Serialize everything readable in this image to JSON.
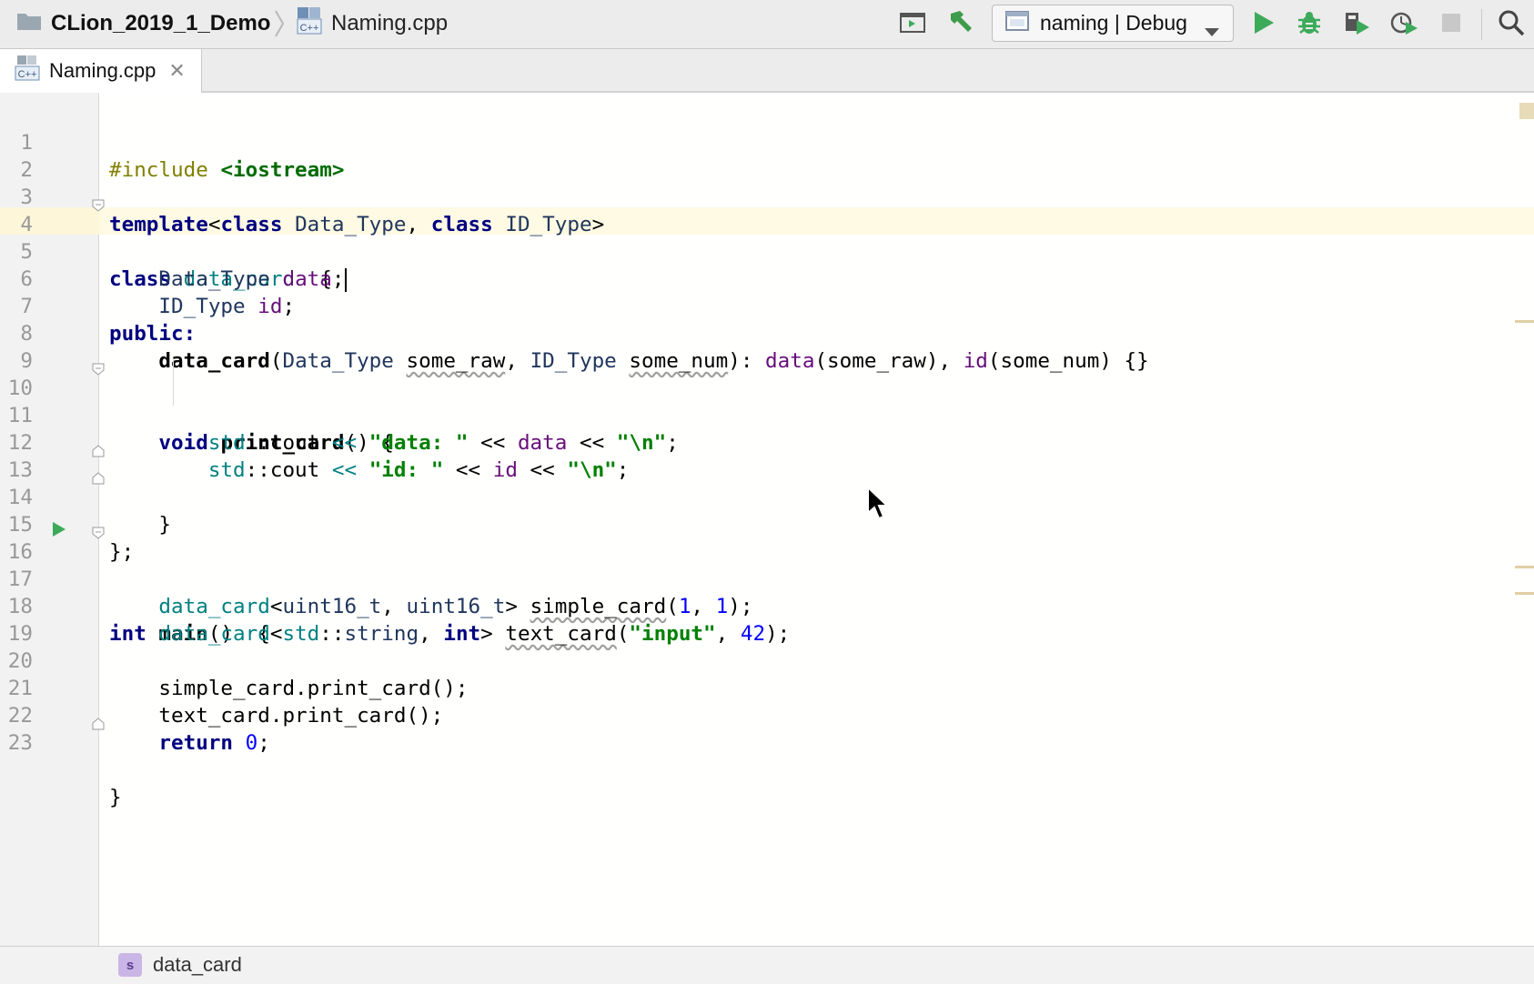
{
  "navbar": {
    "project_name": "CLion_2019_1_Demo",
    "file_name": "Naming.cpp",
    "run_config": "naming | Debug",
    "icons": [
      "terminal-run-icon",
      "build-hammer-icon",
      "run-icon",
      "debug-icon",
      "run-with-coverage-icon",
      "profile-icon",
      "stop-icon",
      "search-icon"
    ]
  },
  "tabs": [
    {
      "label": "Naming.cpp",
      "close": "✕"
    }
  ],
  "editor": {
    "line_numbers": [
      "1",
      "2",
      "3",
      "4",
      "5",
      "6",
      "7",
      "8",
      "9",
      "10",
      "11",
      "12",
      "13",
      "14",
      "15",
      "16",
      "17",
      "18",
      "19",
      "20",
      "21",
      "22",
      "23"
    ],
    "current_line": "5",
    "code": {
      "l1": [
        "#include",
        "<iostream>"
      ],
      "l3": [
        "template",
        "<",
        "class",
        "Data_Type",
        ", ",
        "class",
        "ID_Type",
        ">"
      ],
      "l4": [
        "class",
        "data_card",
        "  {"
      ],
      "l5": [
        "Data_Type",
        "data",
        ";"
      ],
      "l6": [
        "ID_Type",
        "id",
        ";"
      ],
      "l7": [
        "public",
        ":"
      ],
      "l8": [
        "data_card",
        "(",
        "Data_Type",
        "some_raw",
        ", ",
        "ID_Type",
        "some_num",
        "): ",
        "data",
        "(some_raw), ",
        "id",
        "(some_num) {}"
      ],
      "l10": [
        "void",
        "print_card",
        "() {"
      ],
      "l11": [
        "std",
        "::cout ",
        "<<",
        "\"data: \"",
        " << ",
        "data",
        " << ",
        "\"\\n\"",
        ";"
      ],
      "l12": [
        "std",
        "::cout ",
        "<<",
        "\"id: \"",
        " << ",
        "id",
        " << ",
        "\"\\n\"",
        ";"
      ],
      "l13": [
        "}"
      ],
      "l14": [
        "};"
      ],
      "l16": [
        "int",
        "main",
        "()  {"
      ],
      "l17": [
        "data_card",
        "<",
        "uint16_t",
        ", ",
        "uint16_t",
        "> ",
        "simple_card",
        "(",
        "1",
        ", ",
        "1",
        ");"
      ],
      "l18": [
        "data_card",
        "<",
        "std",
        "::",
        "string",
        ", ",
        "int",
        "> ",
        "text_card",
        "(",
        "\"input\"",
        ", ",
        "42",
        ");"
      ],
      "l20": [
        "simple_card.print_card();"
      ],
      "l21": [
        "text_card.print_card();"
      ],
      "l22": [
        "return",
        "0",
        ";"
      ],
      "l23": [
        "}"
      ]
    }
  },
  "footer": {
    "badge": "s",
    "crumb": "data_card"
  },
  "colors": {
    "keyword": "#000080",
    "string": "#008000",
    "number": "#0000ff",
    "class_name": "#008080",
    "field": "#660e7a",
    "current_line": "#fefae3",
    "run_green": "#3daa5a"
  }
}
